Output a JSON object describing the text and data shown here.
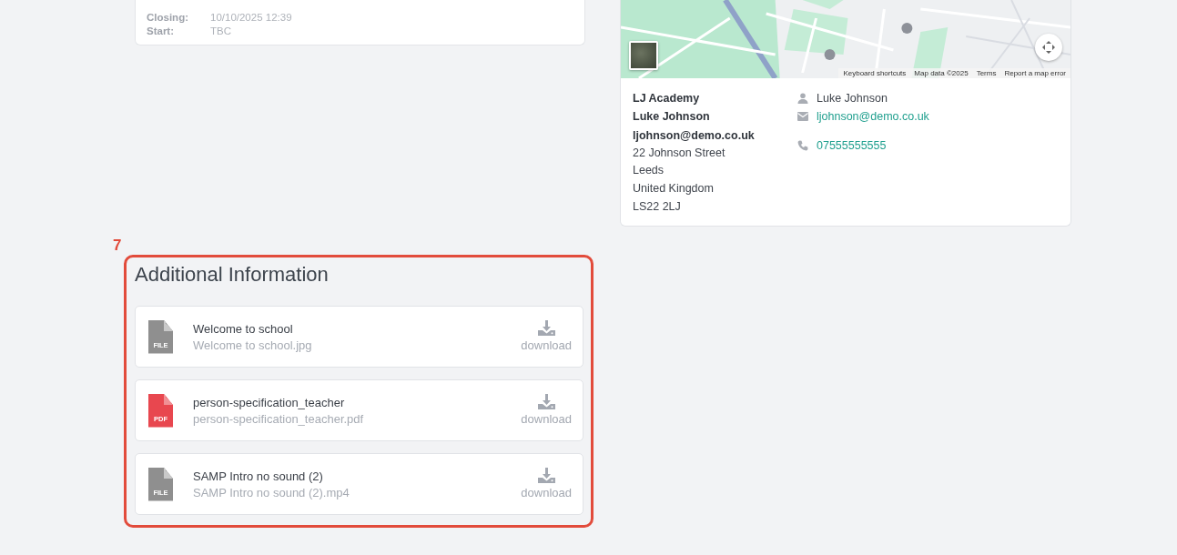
{
  "closing_card": {
    "rows": [
      {
        "label": "Closing:",
        "value": "10/10/2025 12:39"
      },
      {
        "label": "Start:",
        "value": "TBC"
      }
    ]
  },
  "map": {
    "kind": "picture",
    "attribution": [
      "Keyboard shortcuts",
      "Map data ©2025",
      "Terms",
      "Report a map error"
    ]
  },
  "contact": {
    "address": [
      {
        "text": "LJ Academy",
        "emphasis": true
      },
      {
        "text": "Luke Johnson",
        "emphasis": true
      },
      {
        "text": "ljohnson@demo.co.uk",
        "emphasis": true
      },
      {
        "text": "22 Johnson Street",
        "emphasis": false
      },
      {
        "text": "Leeds",
        "emphasis": false
      },
      {
        "text": "United Kingdom",
        "emphasis": false
      },
      {
        "text": "LS22 2LJ",
        "emphasis": false
      }
    ],
    "details": [
      {
        "kind": "person",
        "text": "Luke Johnson"
      },
      {
        "kind": "email",
        "text": "ljohnson@demo.co.uk"
      },
      {
        "kind": "phone",
        "text": "07555555555"
      }
    ]
  },
  "annotation": {
    "number": "7"
  },
  "additional_information": {
    "title": "Additional Information",
    "files": [
      {
        "kind": "file",
        "badge": "FILE",
        "name": "Welcome to school",
        "filename": "Welcome to school.jpg",
        "action": "download"
      },
      {
        "kind": "pdf",
        "badge": "PDF",
        "name": "person-specification_teacher",
        "filename": "person-specification_teacher.pdf",
        "action": "download"
      },
      {
        "kind": "file",
        "badge": "FILE",
        "name": "SAMP Intro no sound (2)",
        "filename": "SAMP Intro no sound (2).mp4",
        "action": "download"
      }
    ]
  }
}
